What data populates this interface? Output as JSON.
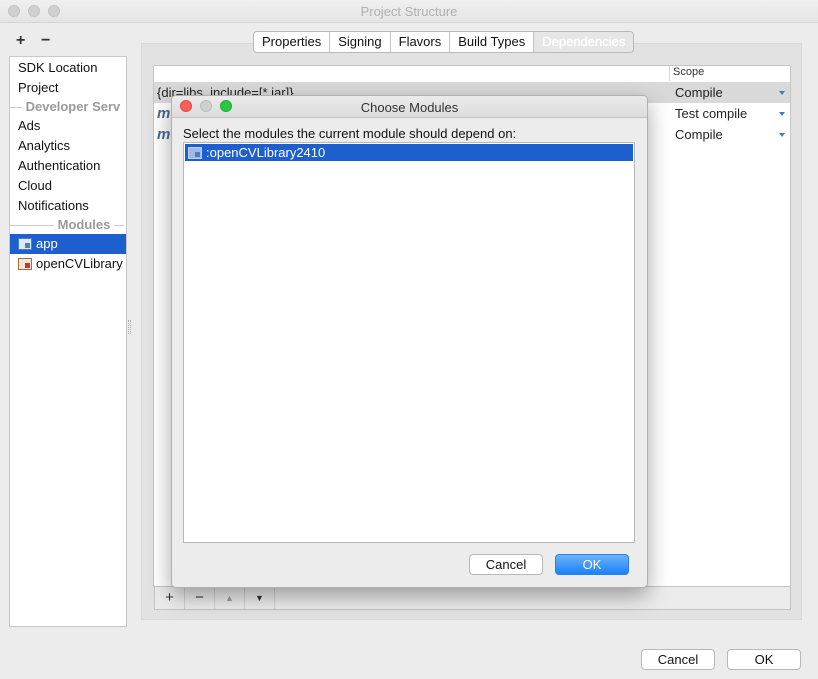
{
  "window": {
    "title": "Project Structure"
  },
  "sidebar": {
    "add": "+",
    "remove": "−",
    "items": [
      {
        "label": "SDK Location"
      },
      {
        "label": "Project"
      },
      {
        "label": "Developer Serv"
      },
      {
        "label": "Ads"
      },
      {
        "label": "Analytics"
      },
      {
        "label": "Authentication"
      },
      {
        "label": "Cloud"
      },
      {
        "label": "Notifications"
      },
      {
        "label": "Modules"
      },
      {
        "label": "app"
      },
      {
        "label": "openCVLibrary"
      }
    ]
  },
  "tabs": [
    {
      "label": "Properties"
    },
    {
      "label": "Signing"
    },
    {
      "label": "Flavors"
    },
    {
      "label": "Build Types"
    },
    {
      "label": "Dependencies"
    }
  ],
  "dependencies": {
    "scope_header": "Scope",
    "rows": [
      {
        "name": "{dir=libs, include=[*.jar]}",
        "scope": "Compile"
      },
      {
        "name": "m",
        "scope": "Test compile"
      },
      {
        "name": "m",
        "scope": "Compile"
      }
    ],
    "toolbar": {
      "add": "+",
      "remove": "−",
      "up": "▲",
      "down": "▼"
    }
  },
  "footer": {
    "cancel": "Cancel",
    "ok": "OK"
  },
  "dialog": {
    "title": "Choose Modules",
    "prompt": "Select the modules the current module should depend on:",
    "modules": [
      ":openCVLibrary2410"
    ],
    "cancel": "Cancel",
    "ok": "OK"
  },
  "colors": {
    "selection": "#1e5fd0",
    "primary_button": "#1a82fb",
    "close": "#fc5f57",
    "minimize_inactive": "#d0d0d0",
    "zoom": "#2ac840"
  }
}
